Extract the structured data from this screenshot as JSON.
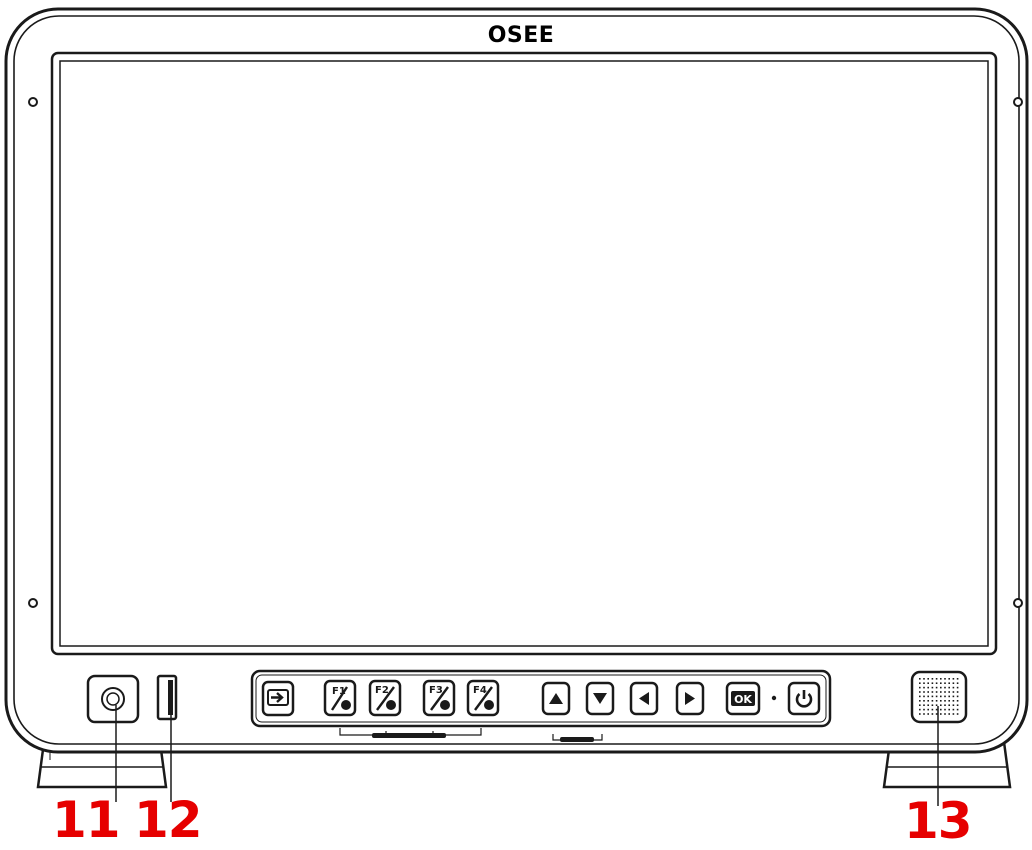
{
  "brand": {
    "logo_text": "OSEE"
  },
  "controls": {
    "input_button": {
      "icon": "input-switch-icon"
    },
    "function_buttons": [
      {
        "label": "F1",
        "icon": "f1-icon"
      },
      {
        "label": "F2",
        "icon": "f2-icon"
      },
      {
        "label": "F3",
        "icon": "f3-icon"
      },
      {
        "label": "F4",
        "icon": "f4-icon"
      }
    ],
    "nav_buttons": [
      {
        "icon": "up-arrow-icon"
      },
      {
        "icon": "down-arrow-icon"
      },
      {
        "icon": "left-arrow-icon"
      },
      {
        "icon": "right-arrow-icon"
      }
    ],
    "ok_label": "OK",
    "power_icon": "power-icon"
  },
  "callouts": {
    "knob": "11",
    "usb": "12",
    "speaker": "13"
  },
  "colors": {
    "callout": "#e60000",
    "outline": "#1a1a1a"
  }
}
